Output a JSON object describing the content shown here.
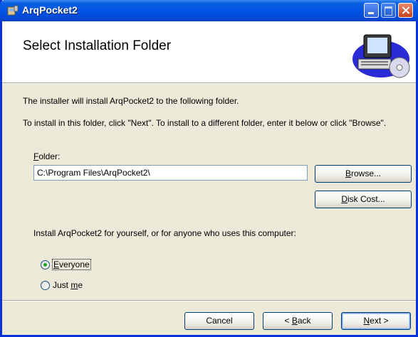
{
  "window": {
    "title": "ArqPocket2",
    "colors": {
      "titlebar": "#0054e3",
      "background": "#ece9d8",
      "close_button": "#c6421d"
    },
    "icons": [
      "installer-icon",
      "minimize-icon",
      "maximize-icon",
      "close-icon",
      "computer-cd-icon"
    ]
  },
  "header": {
    "title": "Select Installation Folder"
  },
  "body": {
    "intro_line1": "The installer will install ArqPocket2 to the following folder.",
    "intro_line2": "To install in this folder, click \"Next\". To install to a different folder, enter it below or click \"Browse\".",
    "folder_label_accel": "F",
    "folder_label_rest": "older:",
    "folder_value": "C:\\Program Files\\ArqPocket2\\",
    "browse_accel": "B",
    "browse_rest": "rowse...",
    "diskcost_accel": "D",
    "diskcost_rest": "isk Cost...",
    "install_for": "Install ArqPocket2 for yourself, or for anyone who uses this computer:",
    "radio_everyone_accel": "E",
    "radio_everyone_rest": "veryone",
    "radio_justme_pre": "Just ",
    "radio_justme_accel": "m",
    "radio_justme_rest": "e",
    "selected_option": "Everyone"
  },
  "footer": {
    "cancel": "Cancel",
    "back_pre": "< ",
    "back_accel": "B",
    "back_rest": "ack",
    "next_accel": "N",
    "next_rest": "ext >"
  }
}
